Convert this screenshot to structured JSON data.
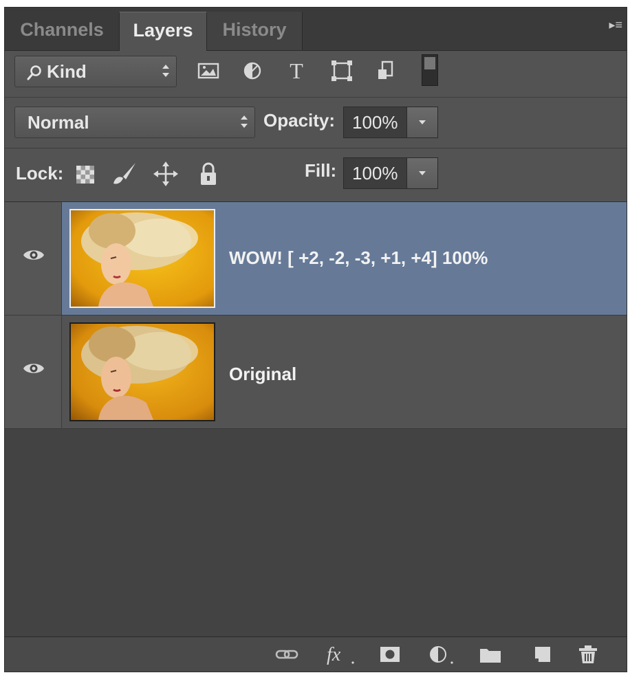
{
  "tabs": [
    {
      "label": "Channels",
      "active": false
    },
    {
      "label": "Layers",
      "active": true
    },
    {
      "label": "History",
      "active": false
    }
  ],
  "filter": {
    "kind_label": "Kind",
    "icons": [
      "image-filter-icon",
      "adjustment-filter-icon",
      "type-filter-icon",
      "shape-filter-icon",
      "smart-object-filter-icon",
      "filter-toggle-icon"
    ]
  },
  "blend": {
    "mode": "Normal",
    "opacity_label": "Opacity:",
    "opacity_value": "100%"
  },
  "lock": {
    "label": "Lock:",
    "icons": [
      "lock-transparent-pixels-icon",
      "lock-image-pixels-icon",
      "lock-position-icon",
      "lock-all-icon"
    ],
    "fill_label": "Fill:",
    "fill_value": "100%"
  },
  "layers": [
    {
      "name": "WOW! [ +2, -2, -3, +1, +4] 100%",
      "visible": true,
      "selected": true
    },
    {
      "name": "Original",
      "visible": true,
      "selected": false
    }
  ],
  "bottom_icons": [
    "link-layers-icon",
    "fx-icon",
    "add-mask-icon",
    "new-adjustment-layer-icon",
    "new-group-icon",
    "new-layer-icon",
    "delete-layer-icon"
  ],
  "colors": {
    "panel_bg": "#535353",
    "selected_layer": "#667a98",
    "thumb_orange": "#e8a10f"
  }
}
